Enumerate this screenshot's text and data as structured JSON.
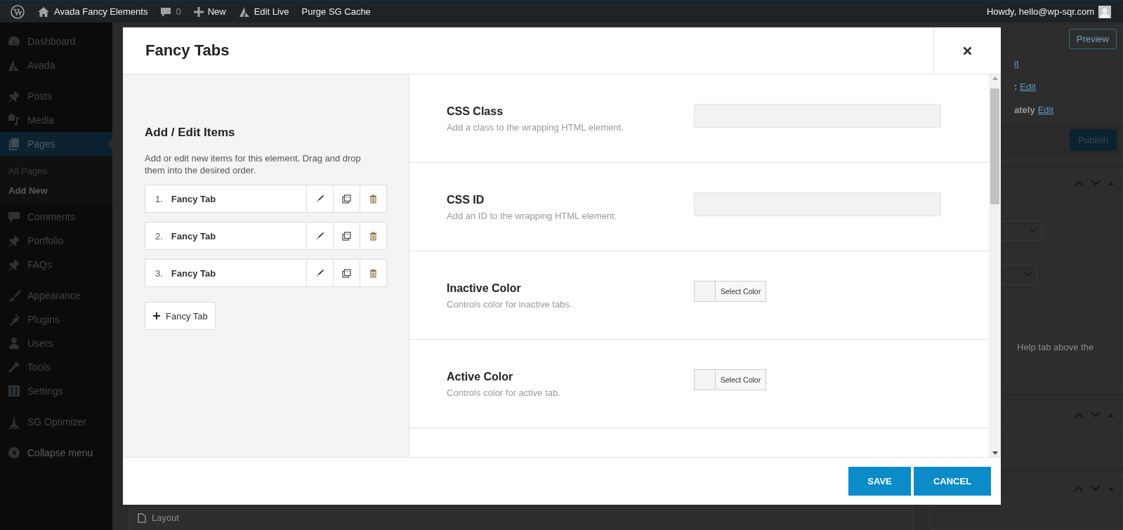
{
  "admin_bar": {
    "site_name": "Avada Fancy Elements",
    "comment_count": "0",
    "new_label": "New",
    "edit_live": "Edit Live",
    "purge_cache": "Purge SG Cache",
    "greeting": "Howdy, hello@wp-sqr.com"
  },
  "sidebar": {
    "groups": [
      [
        {
          "label": "Dashboard",
          "selected": false
        },
        {
          "label": "Avada",
          "selected": false
        }
      ],
      [
        {
          "label": "Posts",
          "selected": false
        },
        {
          "label": "Media",
          "selected": false
        },
        {
          "label": "Pages",
          "selected": true,
          "children": [
            {
              "label": "All Pages",
              "selected": false
            },
            {
              "label": "Add New",
              "selected": true
            }
          ]
        },
        {
          "label": "Comments",
          "selected": false
        },
        {
          "label": "Portfolio",
          "selected": false
        },
        {
          "label": "FAQs",
          "selected": false
        }
      ],
      [
        {
          "label": "Appearance",
          "selected": false
        },
        {
          "label": "Plugins",
          "selected": false
        },
        {
          "label": "Users",
          "selected": false
        },
        {
          "label": "Tools",
          "selected": false
        },
        {
          "label": "Settings",
          "selected": false
        }
      ],
      [
        {
          "label": "SG Optimizer",
          "selected": false
        }
      ]
    ],
    "collapse": "Collapse menu"
  },
  "modal": {
    "title": "Fancy Tabs",
    "items_panel": {
      "heading": "Add / Edit Items",
      "description": "Add or edit new items for this element. Drag and drop them into the desired order.",
      "items": [
        {
          "number": "1.",
          "label": "Fancy Tab"
        },
        {
          "number": "2.",
          "label": "Fancy Tab"
        },
        {
          "number": "3.",
          "label": "Fancy Tab"
        }
      ],
      "add_label": "Fancy Tab"
    },
    "settings": [
      {
        "kind": "text",
        "label": "CSS Class",
        "description": "Add a class to the wrapping HTML element."
      },
      {
        "kind": "text",
        "label": "CSS ID",
        "description": "Add an ID to the wrapping HTML element."
      },
      {
        "kind": "color",
        "label": "Inactive Color",
        "description": "Controls color for inactive tabs.",
        "button": "Select Color"
      },
      {
        "kind": "color",
        "label": "Active Color",
        "description": "Controls color for active tab.",
        "button": "Select Color"
      }
    ],
    "buttons": [
      "SAVE",
      "CANCEL"
    ]
  },
  "background": {
    "preview": "Preview",
    "links": [
      {
        "link": "it"
      },
      {
        "prefix": ":",
        "link": "Edit"
      },
      {
        "prefix": "ately",
        "link": "Edit"
      }
    ],
    "publish": "Publish",
    "help_text": "Help tab above the",
    "layout_label": "Layout"
  }
}
